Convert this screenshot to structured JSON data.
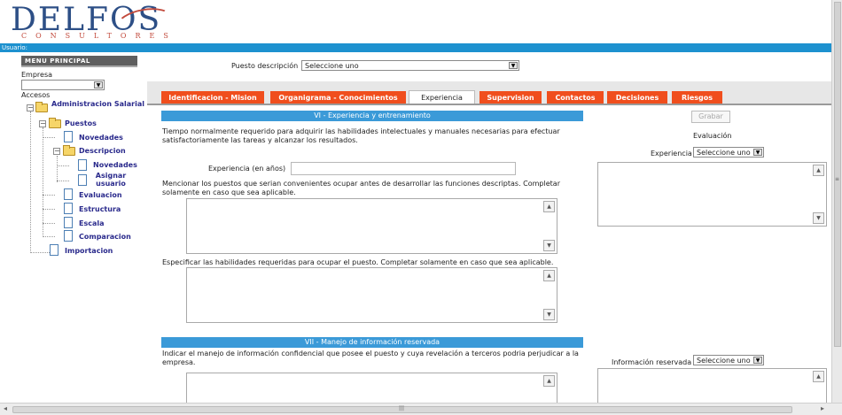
{
  "header": {
    "logo_main": "DELFOS",
    "logo_sub": "CONSULTORES",
    "user_label": "Usuario:"
  },
  "sidebar": {
    "menu_title": "MENU PRINCIPAL",
    "empresa_label": "Empresa",
    "accesos_label": "Accesos",
    "tree": {
      "admin_salarial": "Administracion Salarial",
      "puestos": "Puestos",
      "novedades": "Novedades",
      "descripcion": "Descripcion",
      "desc_novedades": "Novedades",
      "asignar_usuario": "Asignar usuario",
      "evaluacion": "Evaluacion",
      "estructura": "Estructura",
      "escala": "Escala",
      "comparacion": "Comparacion",
      "importacion": "Importacion"
    }
  },
  "puesto": {
    "label": "Puesto descripción",
    "value": "Seleccione uno"
  },
  "tabs": [
    {
      "label": "Identificacion - Mision",
      "active": false
    },
    {
      "label": "Organigrama - Conocimientos",
      "active": false
    },
    {
      "label": "Experiencia",
      "active": true
    },
    {
      "label": "Supervision",
      "active": false
    },
    {
      "label": "Contactos",
      "active": false
    },
    {
      "label": "Decisiones",
      "active": false
    },
    {
      "label": "Riesgos",
      "active": false
    }
  ],
  "section6": {
    "title": "VI - Experiencia y entrenamiento",
    "intro": "Tiempo normalmente requerido para adquirir las habilidades intelectuales y manuales necesarias para efectuar satisfactoriamente las tareas y alcanzar los resultados.",
    "exp_label": "Experiencia (en años)",
    "exp_value": "",
    "puestos_text": "Mencionar los puestos que serian convenientes ocupar antes de desarrollar las funciones descriptas. Completar solamente en caso que sea aplicable.",
    "habilidades_text": "Especificar las habilidades requeridas para ocupar el puesto. Completar solamente en caso que sea aplicable."
  },
  "section7": {
    "title": "VII - Manejo de información reservada",
    "text": "Indicar el manejo de información confidencial que posee el puesto y cuya revelación a terceros podria perjudicar a la empresa."
  },
  "right_panel": {
    "grabar": "Grabar",
    "evaluacion_label": "Evaluación",
    "experiencia_label": "Experiencia",
    "experiencia_value": "Seleccione uno",
    "info_label": "Información reservada",
    "info_value": "Seleccione uno"
  },
  "colors": {
    "tab_orange": "#f04e1d",
    "section_blue": "#3b9ad8",
    "user_bar": "#1d91cf",
    "menu_gray": "#5f5f5f"
  }
}
